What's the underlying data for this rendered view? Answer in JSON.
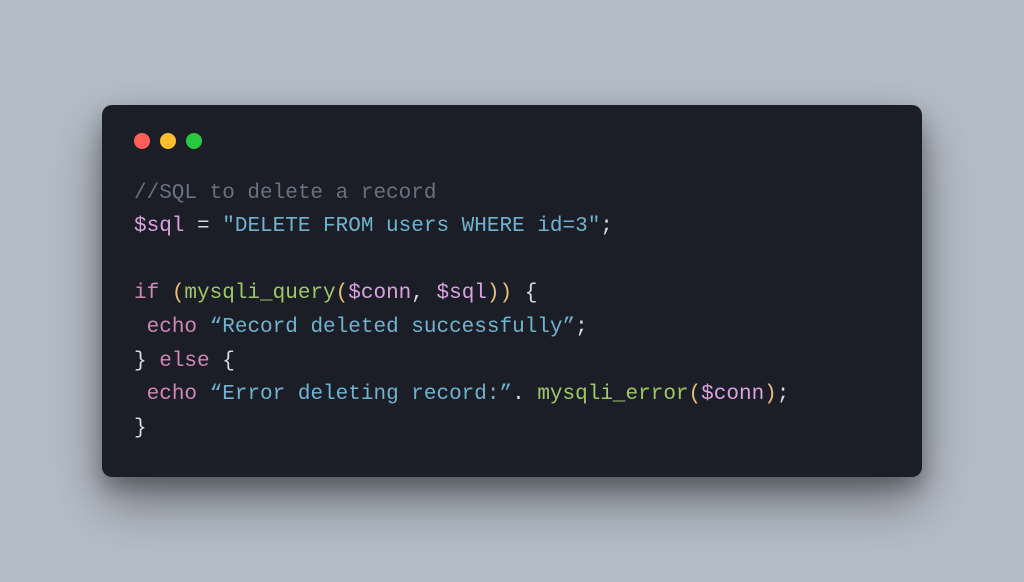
{
  "code": {
    "comment": "//SQL to delete a record",
    "line2": {
      "var": "$sql",
      "eq": " = ",
      "str": "\"DELETE FROM users WHERE id=3\"",
      "semi": ";"
    },
    "line4": {
      "if": "if ",
      "po": "(",
      "fn": "mysqli_query",
      "po2": "(",
      "v1": "$conn",
      "comma": ", ",
      "v2": "$sql",
      "pc2": ")",
      "pc": ")",
      "brace": " {"
    },
    "line5": {
      "indent": " ",
      "echo": "echo",
      "sp": " ",
      "str": "“Record deleted successfully”",
      "semi": ";"
    },
    "line6": {
      "closeb": "} ",
      "else": "else",
      "openb": " {"
    },
    "line7": {
      "indent": " ",
      "echo": "echo",
      "sp": " ",
      "str": "“Error deleting record:”",
      "dot": ". ",
      "fn": "mysqli_error",
      "po": "(",
      "v": "$conn",
      "pc": ")",
      "semi": ";"
    },
    "line8": {
      "closeb": "}"
    }
  }
}
